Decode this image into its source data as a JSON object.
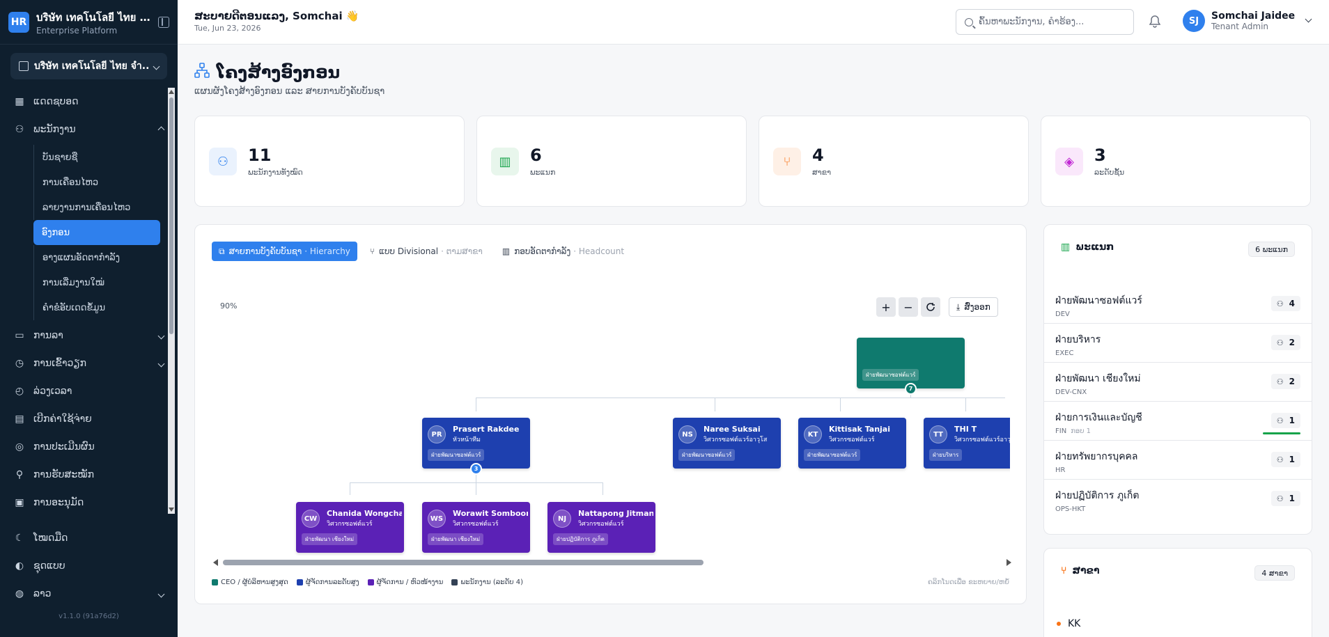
{
  "brand": {
    "logo": "HR",
    "name": "บริษัท เทคโนโลยี ไทย จำกัด",
    "sub": "Enterprise Platform"
  },
  "tenant": {
    "name": "บริษัท เทคโนโลยี ไทย จำ..."
  },
  "nav": {
    "dashboard": "ແດດຊບອດ",
    "employees": "ພະນັກງານ",
    "employees_sub": [
      "ບັນຊາຍຊື",
      "ການເຄື່ອນໄຫວ",
      "ລາຍງານການເຄື່ອນໄຫວ",
      "ອົງກອນ",
      "ອາງແຜນອັດຕາກຳລັງ",
      "ການເລີ່ມງານໃໝ່",
      "ຄຳຂໍອັບເດດຂໍ້ມູນ"
    ],
    "leave": "ການລາ",
    "attendance": "ການເຂົ້າວຽກ",
    "overtime": "ລ່ວງເວລາ",
    "expenses": "ເບີກຄ່າໃຊ້ຈ່າຍ",
    "performance": "ການປະເມີນຜົນ",
    "recruitment": "ການຮັບສະໝັກ",
    "approval": "ການອະນຸມັດ",
    "dark_mode": "ໂໝດມືດ",
    "theme": "ຊຸດແບບ",
    "language": "ລາວ",
    "version": "v1.1.0 (91a76d2)"
  },
  "header": {
    "greeting": "ສະບາຍດີຕອນແລງ, Somchai 👋",
    "date": "Tue, Jun 23, 2026",
    "search_placeholder": "ຄົ້ນຫາພະນັກງານ, ຄຳຮ້ອງ...",
    "user_initials": "SJ",
    "user_name": "Somchai Jaidee",
    "user_role": "Tenant Admin"
  },
  "page": {
    "title": "ໂຄງສ້າງອົງກອນ",
    "subtitle": "ແຜນຜັງໂຄງສ້າງອົງກອນ ແລະ ສາຍການບັງຄັບບັນຊາ"
  },
  "stats": [
    {
      "value": "11",
      "label": "ພະນັກງານທັງໝົດ",
      "color": "#2f80ed",
      "bg": "#eaf2fd",
      "icon": "users-icon"
    },
    {
      "value": "6",
      "label": "ພະແນກ",
      "color": "#16a34a",
      "bg": "#e8f6ec",
      "icon": "building-icon"
    },
    {
      "value": "4",
      "label": "ສາຂາ",
      "color": "#f97316",
      "bg": "#fef0e6",
      "icon": "branch-icon"
    },
    {
      "value": "3",
      "label": "ລະດັບຊັ້ນ",
      "color": "#c026d3",
      "bg": "#fae8fb",
      "icon": "layers-icon"
    }
  ],
  "chart": {
    "tabs": [
      {
        "label": "ສາຍການບັງຄັບບັນຊາ",
        "sub": "· Hierarchy"
      },
      {
        "label": "ແບບ Divisional",
        "sub": "· ຕາມສາຂາ"
      },
      {
        "label": "ກອບອັດຕາກຳລັງ",
        "sub": "· Headcount"
      }
    ],
    "zoom": "90%",
    "export_label": "ສົ່ງອອກ",
    "root": {
      "dept": "ฝ่ายพัฒนาซอฟต์แวร์",
      "badge": "7"
    },
    "level2": [
      {
        "initials": "PR",
        "name": "Prasert Rakdee",
        "title": "หัวหน้าทีม",
        "dept": "ฝ่ายพัฒนาซอฟต์แวร์",
        "badge": "3"
      },
      {
        "initials": "NS",
        "name": "Naree Suksai",
        "title": "วิศวกรซอฟต์แวร์อาวุโส",
        "dept": "ฝ่ายพัฒนาซอฟต์แวร์"
      },
      {
        "initials": "KT",
        "name": "Kittisak Tanjai",
        "title": "วิศวกรซอฟต์แวร์",
        "dept": "ฝ่ายพัฒนาซอฟต์แวร์"
      },
      {
        "initials": "TT",
        "name": "THI T",
        "title": "วิศวกรซอฟต์แวร์อาวุโส",
        "dept": "ฝ่ายบริหาร"
      }
    ],
    "level3": [
      {
        "initials": "CW",
        "name": "Chanida Wongchai",
        "title": "วิศวกรซอฟต์แวร์",
        "dept": "ฝ่ายพัฒนา เชียงใหม่"
      },
      {
        "initials": "WS",
        "name": "Worawit Somboon",
        "title": "วิศวกรซอฟต์แวร์",
        "dept": "ฝ่ายพัฒนา เชียงใหม่"
      },
      {
        "initials": "NJ",
        "name": "Nattapong Jitman",
        "title": "วิศวกรซอฟต์แวร์",
        "dept": "ฝ่ายปฏิบัติการ ภูเก็ต"
      }
    ],
    "legend": [
      {
        "label": "CEO / ຜູ້ບໍລິຫານສູງສຸດ",
        "color": "#0f7a6e"
      },
      {
        "label": "ຜູ້ຈັດການລະດັບສູງ",
        "color": "#1e40af"
      },
      {
        "label": "ຜູ້ຈັດການ / ຫົວໜ້າງານ",
        "color": "#5b21b6"
      },
      {
        "label": "ພະນັກງານ (ລະດັບ 4)",
        "color": "#334155"
      }
    ],
    "hint": "ຄລິກໂນດເພື່ອ ຂະຫຍາຍ/ຫຍໍ້"
  },
  "departments": {
    "title": "ພະແນກ",
    "count_label": "6 ພະແນກ",
    "items": [
      {
        "name": "ฝ่ายพัฒนาซอฟต์แวร์",
        "code": "DEV",
        "sub": "",
        "count": "4"
      },
      {
        "name": "ฝ่ายบริหาร",
        "code": "EXEC",
        "sub": "",
        "count": "2"
      },
      {
        "name": "ฝ่ายพัฒนา เชียงใหม่",
        "code": "DEV-CNX",
        "sub": "",
        "count": "2"
      },
      {
        "name": "ฝ่ายการเงินและบัญชี",
        "code": "FIN",
        "sub": "ກອບ 1",
        "count": "1"
      },
      {
        "name": "ฝ่ายทรัพยากรบุคคล",
        "code": "HR",
        "sub": "",
        "count": "1"
      },
      {
        "name": "ฝ่ายปฏิบัติการ ภูเก็ต",
        "code": "OPS-HKT",
        "sub": "",
        "count": "1"
      }
    ]
  },
  "branches": {
    "title": "ສາຂາ",
    "count_label": "4 ສາຂາ",
    "first": "KK"
  }
}
